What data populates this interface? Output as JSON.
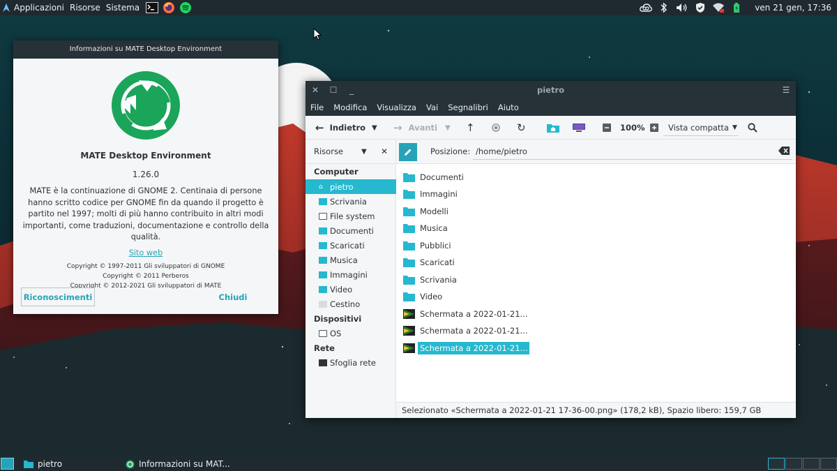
{
  "top_panel": {
    "menus": [
      "Applicazioni",
      "Risorse",
      "Sistema"
    ],
    "clock": "ven 21 gen, 17:36",
    "launchers": [
      "terminal-icon",
      "firefox-icon",
      "spotify-icon"
    ],
    "tray": [
      "creative-cloud-icon",
      "bluetooth-icon",
      "volume-icon",
      "vpn-shield-icon",
      "wifi-icon",
      "battery-icon"
    ]
  },
  "about": {
    "title": "Informazioni su MATE Desktop Environment",
    "app_name": "MATE Desktop Environment",
    "version": "1.26.0",
    "description": "MATE è la continuazione di GNOME 2. Centinaia di persone hanno scritto codice per GNOME fin da quando il progetto è partito nel 1997; molti di più hanno contribuito in altri modi importanti, come traduzioni, documentazione e controllo della qualità.",
    "website": "Sito web",
    "copyright": [
      "Copyright © 1997-2011 Gli sviluppatori di GNOME",
      "Copyright © 2011 Perberos",
      "Copyright © 2012-2021 Gli sviluppatori di MATE"
    ],
    "credits_button": "Riconoscimenti",
    "close_button": "Chiudi",
    "accent": "#26a3b8",
    "logo_color": "#1aa55a"
  },
  "file_manager": {
    "title": "pietro",
    "menu": [
      "File",
      "Modifica",
      "Visualizza",
      "Vai",
      "Segnalibri",
      "Aiuto"
    ],
    "toolbar": {
      "back": "Indietro",
      "forward": "Avanti",
      "zoom": "100%",
      "view": "Vista compatta"
    },
    "sidebar_title": "Risorse",
    "location_label": "Posizione:",
    "location": "/home/pietro",
    "sections": {
      "computer": "Computer",
      "devices": "Dispositivi",
      "network": "Rete"
    },
    "sidebar": {
      "computer": [
        "pietro",
        "Scrivania",
        "File system",
        "Documenti",
        "Scaricati",
        "Musica",
        "Immagini",
        "Video",
        "Cestino"
      ],
      "devices": [
        "OS"
      ],
      "network": [
        "Sfoglia rete"
      ]
    },
    "files": [
      "Documenti",
      "Immagini",
      "Modelli",
      "Musica",
      "Pubblici",
      "Scaricati",
      "Scrivania",
      "Video",
      "Schermata a 2022-01-21...",
      "Schermata a 2022-01-21...",
      "Schermata a 2022-01-21..."
    ],
    "status": "Selezionato «Schermata a 2022-01-21 17-36-00.png» (178,2 kB), Spazio libero: 159,7 GB",
    "selection_color": "#26b8cf"
  },
  "taskbar": {
    "tasks": [
      "pietro",
      "Informazioni su MAT..."
    ]
  }
}
